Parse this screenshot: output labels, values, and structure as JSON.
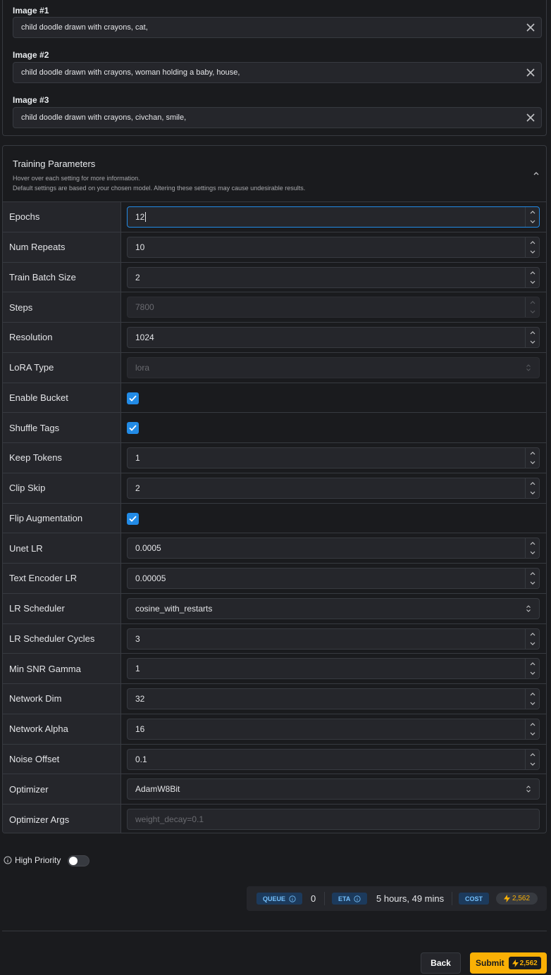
{
  "images": [
    {
      "label": "Image #1",
      "prompt": "child doodle drawn with crayons, cat,"
    },
    {
      "label": "Image #2",
      "prompt": "child doodle drawn with crayons, woman holding a baby, house,"
    },
    {
      "label": "Image #3",
      "prompt": "child doodle drawn with crayons, civchan, smile,"
    }
  ],
  "training": {
    "title": "Training Parameters",
    "subtitle_1": "Hover over each setting for more information.",
    "subtitle_2": "Default settings are based on your chosen model. Altering these settings may cause undesirable results.",
    "params": [
      {
        "label": "Epochs",
        "value": "12",
        "kind": "number",
        "focused": true
      },
      {
        "label": "Num Repeats",
        "value": "10",
        "kind": "number"
      },
      {
        "label": "Train Batch Size",
        "value": "2",
        "kind": "number"
      },
      {
        "label": "Steps",
        "value": "7800",
        "kind": "number",
        "disabled": true
      },
      {
        "label": "Resolution",
        "value": "1024",
        "kind": "number"
      },
      {
        "label": "LoRA Type",
        "value": "lora",
        "kind": "select",
        "disabled": true
      },
      {
        "label": "Enable Bucket",
        "checked": true,
        "kind": "checkbox"
      },
      {
        "label": "Shuffle Tags",
        "checked": true,
        "kind": "checkbox"
      },
      {
        "label": "Keep Tokens",
        "value": "1",
        "kind": "number"
      },
      {
        "label": "Clip Skip",
        "value": "2",
        "kind": "number"
      },
      {
        "label": "Flip Augmentation",
        "checked": true,
        "kind": "checkbox"
      },
      {
        "label": "Unet LR",
        "value": "0.0005",
        "kind": "number"
      },
      {
        "label": "Text Encoder LR",
        "value": "0.00005",
        "kind": "number"
      },
      {
        "label": "LR Scheduler",
        "value": "cosine_with_restarts",
        "kind": "select"
      },
      {
        "label": "LR Scheduler Cycles",
        "value": "3",
        "kind": "number"
      },
      {
        "label": "Min SNR Gamma",
        "value": "1",
        "kind": "number"
      },
      {
        "label": "Network Dim",
        "value": "32",
        "kind": "number"
      },
      {
        "label": "Network Alpha",
        "value": "16",
        "kind": "number"
      },
      {
        "label": "Noise Offset",
        "value": "0.1",
        "kind": "number"
      },
      {
        "label": "Optimizer",
        "value": "AdamW8Bit",
        "kind": "select"
      },
      {
        "label": "Optimizer Args",
        "placeholder": "weight_decay=0.1",
        "kind": "text"
      }
    ]
  },
  "high_priority": {
    "label": "High Priority",
    "enabled": false
  },
  "stats": {
    "queue_label": "QUEUE",
    "queue_value": "0",
    "eta_label": "ETA",
    "eta_value": "5 hours, 49 mins",
    "cost_label": "COST",
    "cost_value": "2,562"
  },
  "actions": {
    "back_label": "Back",
    "submit_label": "Submit",
    "submit_cost": "2,562"
  },
  "colors": {
    "accent": "#228be6",
    "submit": "#fab005",
    "background": "#1a1b1e",
    "panel": "#25262b",
    "border": "#373a40"
  }
}
